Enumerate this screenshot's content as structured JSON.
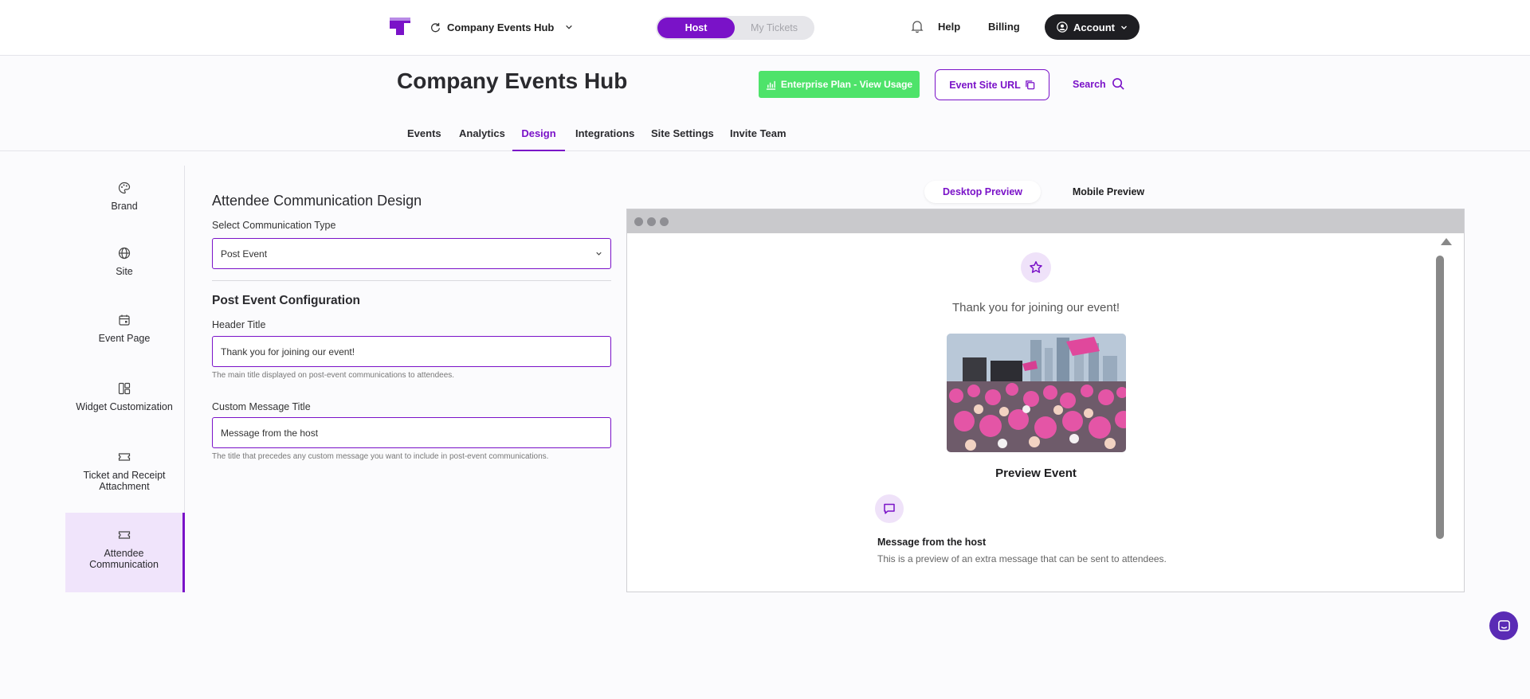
{
  "topbar": {
    "workspace_name": "Company Events Hub",
    "toggle": {
      "active": "Host",
      "inactive": "My Tickets"
    },
    "help_label": "Help",
    "billing_label": "Billing",
    "account_label": "Account"
  },
  "header": {
    "title": "Company Events Hub",
    "plan_label": "Enterprise Plan - View Usage",
    "site_url_label": "Event Site URL",
    "search_label": "Search"
  },
  "tabs": [
    {
      "label": "Events"
    },
    {
      "label": "Analytics"
    },
    {
      "label": "Design"
    },
    {
      "label": "Integrations"
    },
    {
      "label": "Site Settings"
    },
    {
      "label": "Invite Team"
    }
  ],
  "active_tab": "Design",
  "sidebar": {
    "items": [
      {
        "label": "Brand",
        "icon": "palette-icon"
      },
      {
        "label": "Site",
        "icon": "globe-icon"
      },
      {
        "label": "Event Page",
        "icon": "calendar-icon"
      },
      {
        "label": "Widget Customization",
        "icon": "layout-icon"
      },
      {
        "label": "Ticket and Receipt Attachment",
        "icon": "ticket-icon"
      },
      {
        "label": "Attendee Communication",
        "icon": "ticket-icon"
      }
    ],
    "active": "Attendee Communication"
  },
  "form": {
    "heading": "Attendee Communication Design",
    "comm_type_label": "Select Communication Type",
    "comm_type_value": "Post Event",
    "section_title": "Post Event Configuration",
    "header_title_label": "Header Title",
    "header_title_value": "Thank you for joining our event!",
    "header_title_help": "The main title displayed on post-event communications to attendees.",
    "custom_msg_label": "Custom Message Title",
    "custom_msg_value": "Message from the host",
    "custom_msg_help": "The title that precedes any custom message you want to include in post-event communications."
  },
  "preview": {
    "tabs": {
      "desktop": "Desktop Preview",
      "mobile": "Mobile Preview"
    },
    "active": "Desktop Preview",
    "header": "Thank you for joining our event!",
    "caption": "Preview Event",
    "message_title": "Message from the host",
    "message_body": "This is a preview of an extra message that can be sent to attendees."
  },
  "colors": {
    "accent": "#7a12c8",
    "plan_green": "#4ee36a",
    "account_bg": "#1e1e22"
  }
}
